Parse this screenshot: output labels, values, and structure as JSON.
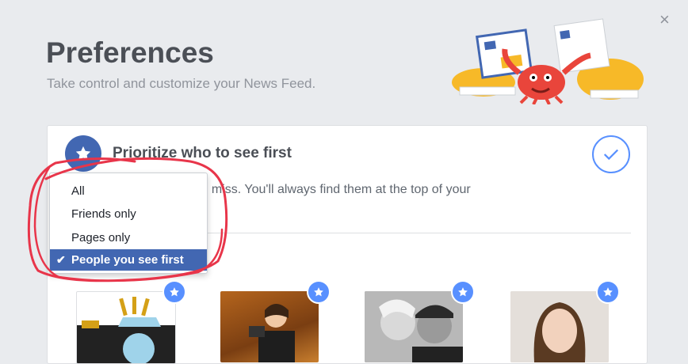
{
  "dialog": {
    "close_label": "×",
    "title": "Preferences",
    "subtitle": "Take control and customize your News Feed."
  },
  "card": {
    "title": "Prioritize who to see first",
    "description": "you don't want to miss. You'll always find them at the top of your",
    "icon": "star-icon",
    "done_icon": "checkmark-icon"
  },
  "dropdown": {
    "items": [
      {
        "label": "All",
        "selected": false
      },
      {
        "label": "Friends only",
        "selected": false
      },
      {
        "label": "Pages only",
        "selected": false
      },
      {
        "label": "People you see first",
        "selected": true
      }
    ],
    "check_glyph": "✔"
  },
  "colors": {
    "accent": "#4267b2",
    "badge": "#5890ff",
    "annotation": "#e8354a"
  }
}
